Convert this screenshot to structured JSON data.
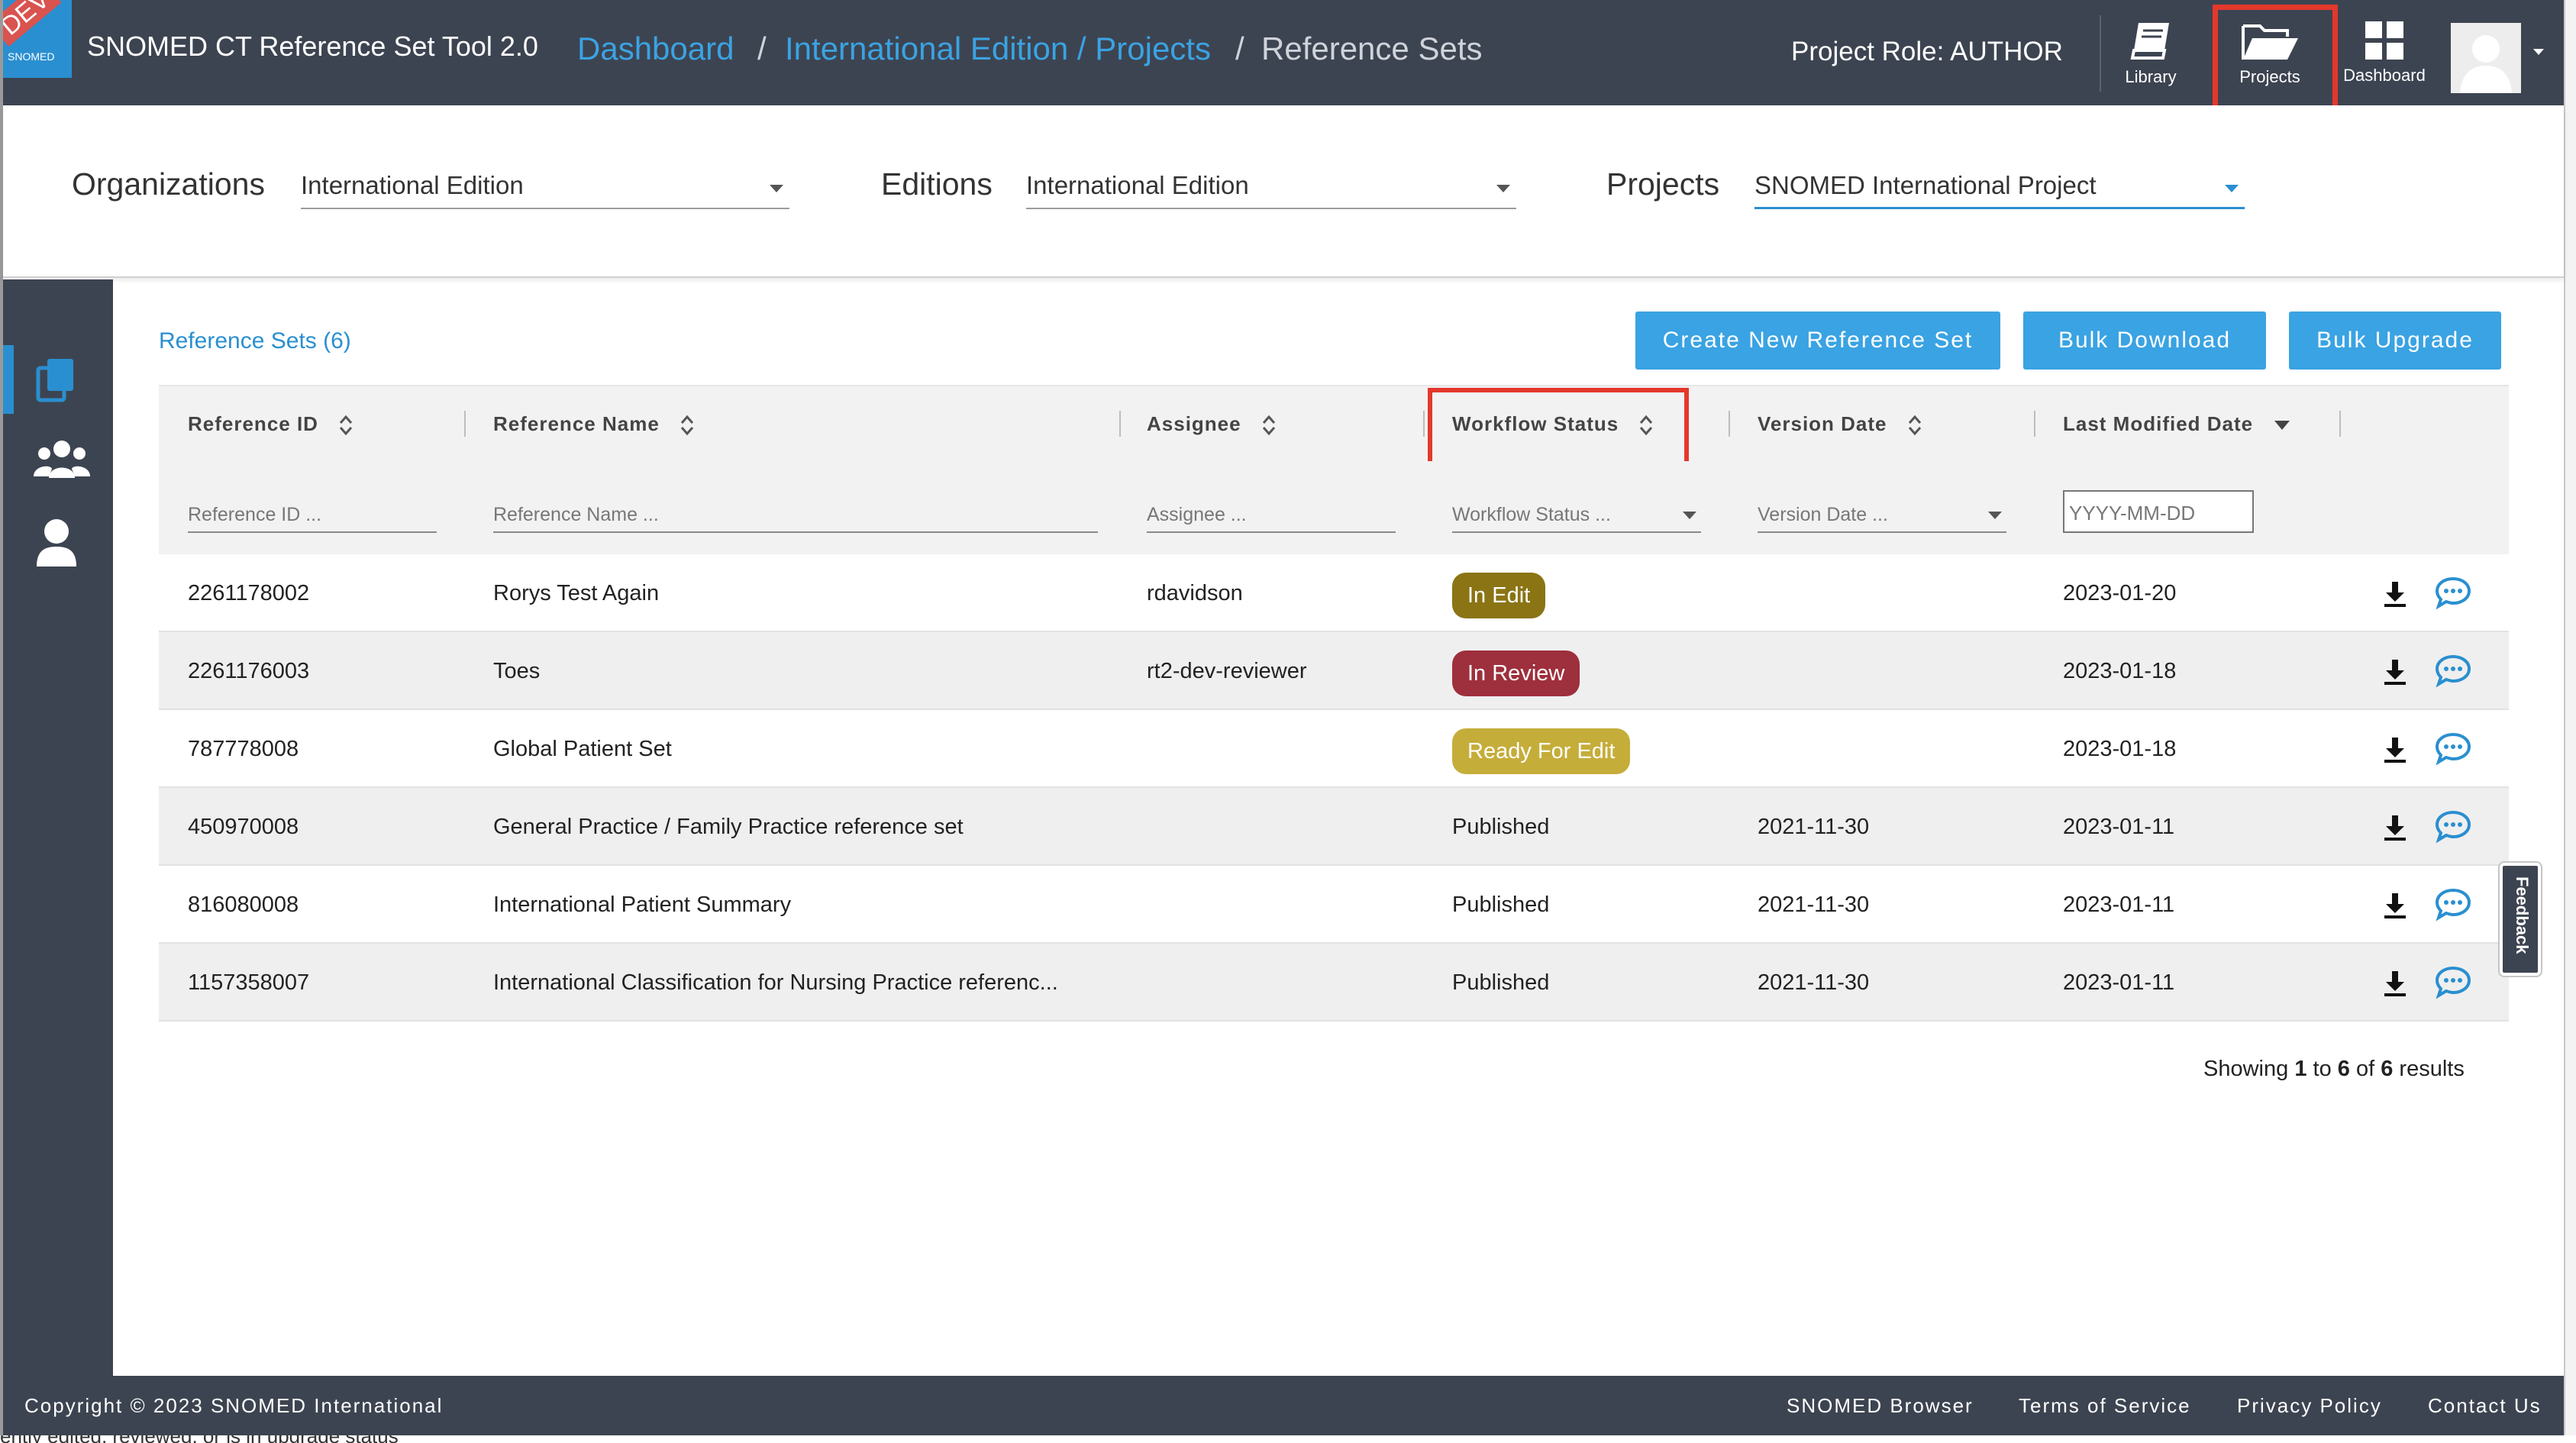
{
  "header": {
    "logo_badge": "DEV",
    "logo_text": "SNOMED",
    "app_title": "SNOMED CT Reference Set Tool 2.0",
    "breadcrumb": {
      "dashboard": "Dashboard",
      "sep1": "/",
      "projects": "International Edition / Projects",
      "sep2": "/",
      "current": "Reference Sets"
    },
    "project_role": "Project Role: AUTHOR",
    "nav": {
      "library": "Library",
      "projects": "Projects",
      "dashboard": "Dashboard"
    }
  },
  "filters_bar": {
    "organizations_label": "Organizations",
    "organizations_value": "International Edition",
    "editions_label": "Editions",
    "editions_value": "International Edition",
    "projects_label": "Projects",
    "projects_value": "SNOMED International Project"
  },
  "sidebar": {
    "items": [
      "copy-documents-icon",
      "users-group-icon",
      "user-icon"
    ],
    "active_index": 0
  },
  "main": {
    "title": "Reference Sets (6)",
    "buttons": {
      "create": "Create New Reference Set",
      "bulk_download": "Bulk Download",
      "bulk_upgrade": "Bulk Upgrade"
    }
  },
  "table": {
    "columns": [
      "Reference ID",
      "Reference Name",
      "Assignee",
      "Workflow Status",
      "Version Date",
      "Last Modified Date"
    ],
    "filter_placeholders": [
      "Reference ID ...",
      "Reference Name ...",
      "Assignee ...",
      "Workflow Status ...",
      "Version Date ...",
      "YYYY-MM-DD"
    ],
    "rows": [
      {
        "id": "2261178002",
        "name": "Rorys Test Again",
        "assignee": "rdavidson",
        "status": "In Edit",
        "version_date": "",
        "last_modified": "2023-01-20"
      },
      {
        "id": "2261176003",
        "name": "Toes",
        "assignee": "rt2-dev-reviewer",
        "status": "In Review",
        "version_date": "",
        "last_modified": "2023-01-18"
      },
      {
        "id": "787778008",
        "name": "Global Patient Set",
        "assignee": "",
        "status": "Ready For Edit",
        "version_date": "",
        "last_modified": "2023-01-18"
      },
      {
        "id": "450970008",
        "name": "General Practice / Family Practice reference set",
        "assignee": "",
        "status": "Published",
        "version_date": "2021-11-30",
        "last_modified": "2023-01-11"
      },
      {
        "id": "816080008",
        "name": "International Patient Summary",
        "assignee": "",
        "status": "Published",
        "version_date": "2021-11-30",
        "last_modified": "2023-01-11"
      },
      {
        "id": "1157358007",
        "name": "International Classification for Nursing Practice referenc...",
        "assignee": "",
        "status": "Published",
        "version_date": "2021-11-30",
        "last_modified": "2023-01-11"
      }
    ],
    "status_colors": {
      "In Edit": "#8a7414",
      "In Review": "#9e2f3c",
      "Ready For Edit": "#c5ad3a"
    },
    "showing": {
      "pre": "Showing ",
      "from": "1",
      "mid1": " to ",
      "to": "6",
      "mid2": " of ",
      "total": "6",
      "post": " results"
    }
  },
  "feedback": "Feedback",
  "footer": {
    "copyright": "Copyright © 2023 SNOMED International",
    "links": [
      "SNOMED Browser",
      "Terms of Service",
      "Privacy Policy",
      "Contact Us"
    ]
  },
  "bottom_strip_text": "ently edited, reviewed, or is in upgrade status"
}
